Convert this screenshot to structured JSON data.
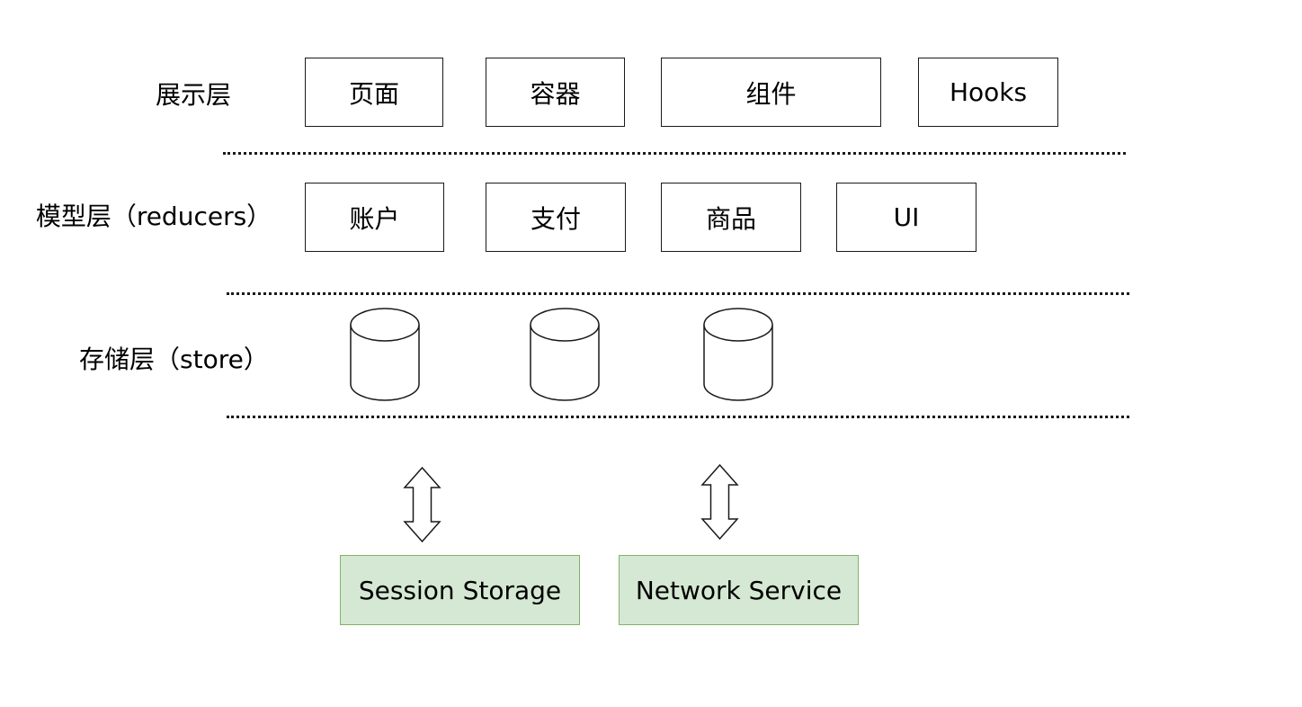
{
  "layers": {
    "presentation": {
      "label": "展示层",
      "items": [
        "页面",
        "容器",
        "组件",
        "Hooks"
      ]
    },
    "model": {
      "label": "模型层（reducers）",
      "items": [
        "账户",
        "支付",
        "商品",
        "UI"
      ]
    },
    "storage": {
      "label": "存储层（store）",
      "store_count": 3
    }
  },
  "services": {
    "items": [
      "Session Storage",
      "Network Service"
    ],
    "fill_color": "#d5e8d4",
    "border_color": "#82b366"
  },
  "icons": {
    "store": "database-cylinder-icon",
    "connector": "double-arrow-vertical-icon"
  }
}
